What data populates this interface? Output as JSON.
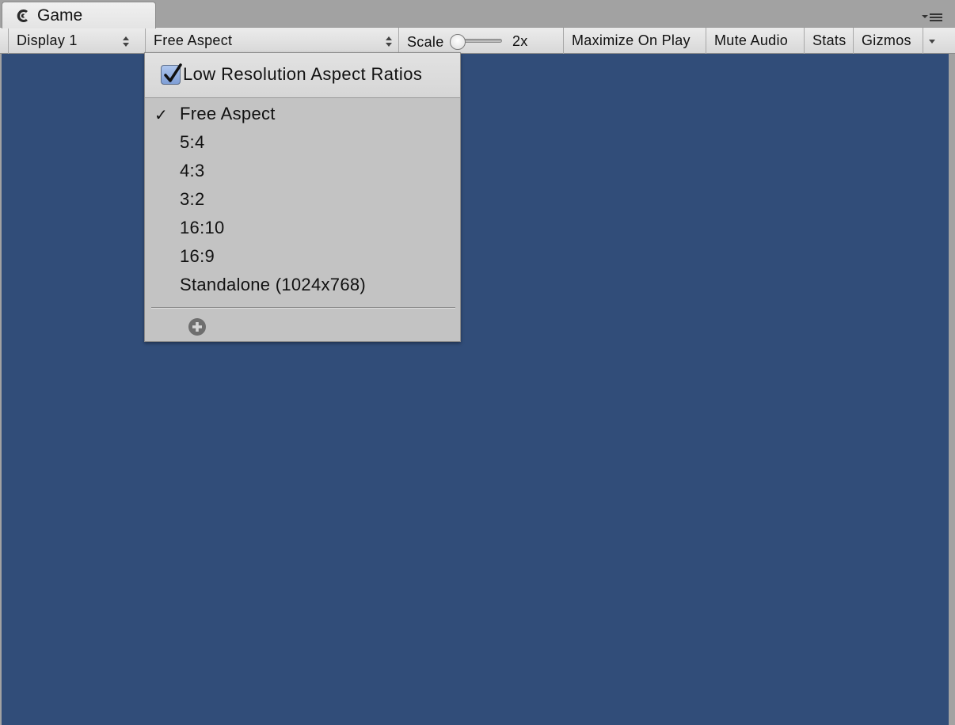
{
  "tab": {
    "title": "Game",
    "icon": "pacman-game-icon"
  },
  "window": {
    "menu_icon": "window-menu-icon"
  },
  "toolbar": {
    "display": "Display 1",
    "aspect": "Free Aspect",
    "scale_label": "Scale",
    "scale_value": "2x",
    "scale_slider_level": 0.05,
    "maximize": "Maximize On Play",
    "mute": "Mute Audio",
    "stats": "Stats",
    "gizmos": "Gizmos"
  },
  "dropdown": {
    "low_res_label": "Low Resolution Aspect Ratios",
    "low_res_checked": true,
    "check_glyph": "✓",
    "items": [
      {
        "label": "Free Aspect",
        "selected": true
      },
      {
        "label": "5:4",
        "selected": false
      },
      {
        "label": "4:3",
        "selected": false
      },
      {
        "label": "3:2",
        "selected": false
      },
      {
        "label": "16:10",
        "selected": false
      },
      {
        "label": "16:9",
        "selected": false
      },
      {
        "label": "Standalone (1024x768)",
        "selected": false
      }
    ],
    "add_icon": "add-circle-icon"
  },
  "colors": {
    "game_background": "#314d79",
    "panel_gray": "#a2a2a2",
    "menu_background": "#c3c3c3",
    "checkbox_blue": "#7e9ed6"
  }
}
